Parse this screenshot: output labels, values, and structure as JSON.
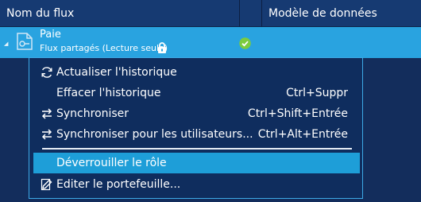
{
  "table": {
    "columns": [
      "Nom du flux",
      "Modèle de données"
    ]
  },
  "row": {
    "title": "Paie",
    "subtitle": "Flux partagés (Lecture seule)",
    "status_icon": "check-circle-icon",
    "colors": {
      "selected_bg": "#29a3e0",
      "status_ok": "#7ccc3e"
    }
  },
  "menu": {
    "items": [
      {
        "label": "Actualiser l'historique",
        "shortcut": "",
        "icon": "refresh-icon"
      },
      {
        "label": "Effacer l'historique",
        "shortcut": "Ctrl+Suppr",
        "icon": ""
      },
      {
        "label": "Synchroniser",
        "shortcut": "Ctrl+Shift+Entrée",
        "icon": "sync-arrows-icon"
      },
      {
        "label": "Synchroniser pour les utilisateurs...",
        "shortcut": "Ctrl+Alt+Entrée",
        "icon": "sync-arrows-icon"
      },
      {
        "label": "Déverrouiller le rôle",
        "shortcut": "",
        "icon": "",
        "highlighted": true
      },
      {
        "label": "Editer le portefeuille...",
        "shortcut": "",
        "icon": "edit-pencil-icon"
      }
    ]
  }
}
